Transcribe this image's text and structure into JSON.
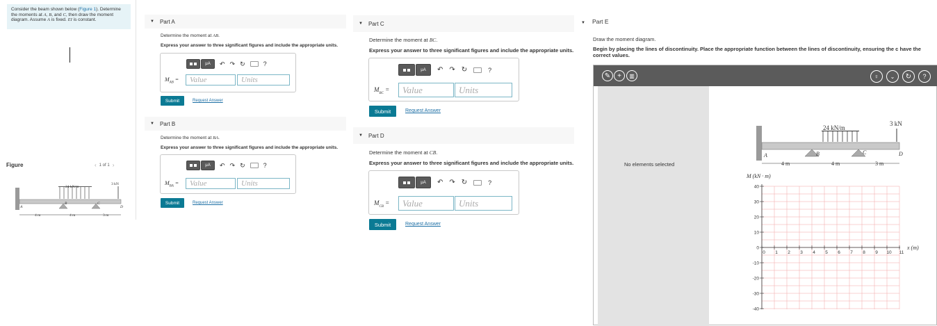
{
  "problem": {
    "text_before_link": "Consider the beam shown below (",
    "link": "Figure 1",
    "text_after_link": "). Determine the moments at ",
    "vars1": "A",
    "sep1": ", ",
    "vars2": "B",
    "sep2": ", and ",
    "vars3": "C",
    "text_mid": ", then draw the moment diagram. Assume ",
    "vars4": "A",
    "text_mid2": " is fixed. ",
    "vars5": "EI",
    "text_end": " is constant."
  },
  "figure": {
    "label": "Figure",
    "pager": "1 of 1",
    "load_dist": "24 kN/m",
    "load_point": "3 kN",
    "pt_a": "A",
    "pt_b": "B",
    "pt_c": "C",
    "pt_d": "D",
    "dim1": "4 m",
    "dim2": "4 m",
    "dim3": "3 m"
  },
  "parts": {
    "a": {
      "title": "Part A",
      "prompt": "Determine the moment at ",
      "var": "AB",
      "instr": "Express your answer to three significant figures and include the appropriate units.",
      "label_main": "M",
      "label_sub": "AB",
      "eq": " =",
      "value_placeholder": "Value",
      "units_placeholder": "Units",
      "submit": "Submit",
      "request": "Request Answer"
    },
    "b": {
      "title": "Part B",
      "prompt": "Determine the moment at ",
      "var": "BA",
      "instr": "Express your answer to three significant figures and include the appropriate units.",
      "label_main": "M",
      "label_sub": "BA",
      "eq": " =",
      "value_placeholder": "Value",
      "units_placeholder": "Units",
      "submit": "Submit",
      "request": "Request Answer"
    },
    "c": {
      "title": "Part C",
      "prompt": "Determine the moment at ",
      "var": "BC",
      "instr": "Express your answer to three significant figures and include the appropriate units.",
      "label_main": "M",
      "label_sub": "BC",
      "eq": " =",
      "value_placeholder": "Value",
      "units_placeholder": "Units",
      "submit": "Submit",
      "request": "Request Answer"
    },
    "d": {
      "title": "Part D",
      "prompt": "Determine the moment at ",
      "var": "CB",
      "instr": "Express your answer to three significant figures and include the appropriate units.",
      "label_main": "M",
      "label_sub": "CB",
      "eq": " =",
      "value_placeholder": "Value",
      "units_placeholder": "Units",
      "submit": "Submit",
      "request": "Request Answer"
    },
    "e": {
      "title": "Part E",
      "prompt": "Draw the moment diagram.",
      "instr": "Begin by placing the lines of discontinuity. Place the appropriate function between the lines of discontinuity, ensuring the c have the correct values.",
      "no_elements": "No elements selected",
      "y_axis_label": "M (kN · m)",
      "x_axis_label": "x (m)",
      "y_ticks": [
        "40",
        "30",
        "20",
        "10",
        "0",
        "-10",
        "-20",
        "-30",
        "-40"
      ],
      "x_ticks": [
        "0",
        "1",
        "2",
        "3",
        "4",
        "5",
        "6",
        "7",
        "8",
        "9",
        "10",
        "11"
      ]
    }
  },
  "toolbar": {
    "mu": "μA",
    "help": "?"
  },
  "colors": {
    "accent": "#0b7a94",
    "link": "#1d6fa5",
    "grid": "#f2a5a5",
    "field_border": "#7bb6c6"
  }
}
